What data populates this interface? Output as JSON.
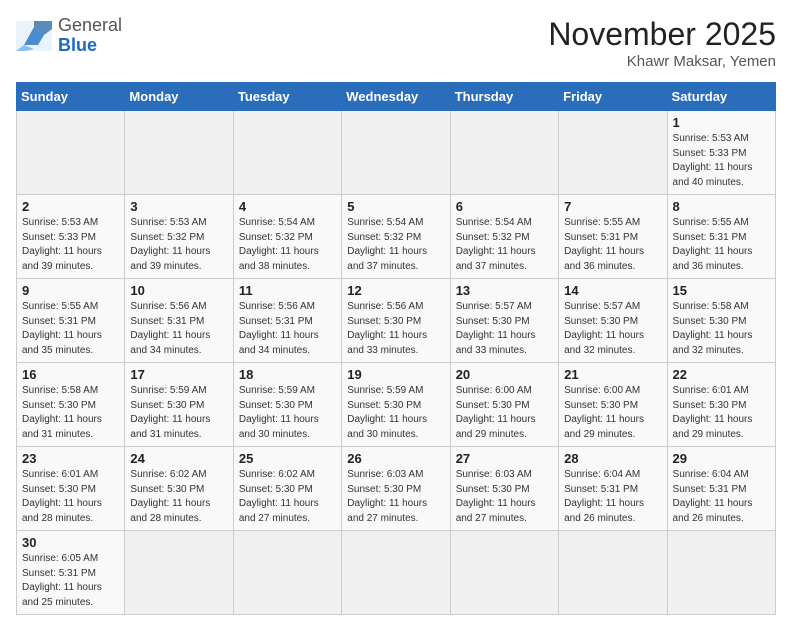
{
  "header": {
    "logo_general": "General",
    "logo_blue": "Blue",
    "month_year": "November 2025",
    "location": "Khawr Maksar, Yemen"
  },
  "weekdays": [
    "Sunday",
    "Monday",
    "Tuesday",
    "Wednesday",
    "Thursday",
    "Friday",
    "Saturday"
  ],
  "weeks": [
    [
      {
        "day": "",
        "info": ""
      },
      {
        "day": "",
        "info": ""
      },
      {
        "day": "",
        "info": ""
      },
      {
        "day": "",
        "info": ""
      },
      {
        "day": "",
        "info": ""
      },
      {
        "day": "",
        "info": ""
      },
      {
        "day": "1",
        "info": "Sunrise: 5:53 AM\nSunset: 5:33 PM\nDaylight: 11 hours\nand 40 minutes."
      }
    ],
    [
      {
        "day": "2",
        "info": "Sunrise: 5:53 AM\nSunset: 5:33 PM\nDaylight: 11 hours\nand 39 minutes."
      },
      {
        "day": "3",
        "info": "Sunrise: 5:53 AM\nSunset: 5:32 PM\nDaylight: 11 hours\nand 39 minutes."
      },
      {
        "day": "4",
        "info": "Sunrise: 5:54 AM\nSunset: 5:32 PM\nDaylight: 11 hours\nand 38 minutes."
      },
      {
        "day": "5",
        "info": "Sunrise: 5:54 AM\nSunset: 5:32 PM\nDaylight: 11 hours\nand 37 minutes."
      },
      {
        "day": "6",
        "info": "Sunrise: 5:54 AM\nSunset: 5:32 PM\nDaylight: 11 hours\nand 37 minutes."
      },
      {
        "day": "7",
        "info": "Sunrise: 5:55 AM\nSunset: 5:31 PM\nDaylight: 11 hours\nand 36 minutes."
      },
      {
        "day": "8",
        "info": "Sunrise: 5:55 AM\nSunset: 5:31 PM\nDaylight: 11 hours\nand 36 minutes."
      }
    ],
    [
      {
        "day": "9",
        "info": "Sunrise: 5:55 AM\nSunset: 5:31 PM\nDaylight: 11 hours\nand 35 minutes."
      },
      {
        "day": "10",
        "info": "Sunrise: 5:56 AM\nSunset: 5:31 PM\nDaylight: 11 hours\nand 34 minutes."
      },
      {
        "day": "11",
        "info": "Sunrise: 5:56 AM\nSunset: 5:31 PM\nDaylight: 11 hours\nand 34 minutes."
      },
      {
        "day": "12",
        "info": "Sunrise: 5:56 AM\nSunset: 5:30 PM\nDaylight: 11 hours\nand 33 minutes."
      },
      {
        "day": "13",
        "info": "Sunrise: 5:57 AM\nSunset: 5:30 PM\nDaylight: 11 hours\nand 33 minutes."
      },
      {
        "day": "14",
        "info": "Sunrise: 5:57 AM\nSunset: 5:30 PM\nDaylight: 11 hours\nand 32 minutes."
      },
      {
        "day": "15",
        "info": "Sunrise: 5:58 AM\nSunset: 5:30 PM\nDaylight: 11 hours\nand 32 minutes."
      }
    ],
    [
      {
        "day": "16",
        "info": "Sunrise: 5:58 AM\nSunset: 5:30 PM\nDaylight: 11 hours\nand 31 minutes."
      },
      {
        "day": "17",
        "info": "Sunrise: 5:59 AM\nSunset: 5:30 PM\nDaylight: 11 hours\nand 31 minutes."
      },
      {
        "day": "18",
        "info": "Sunrise: 5:59 AM\nSunset: 5:30 PM\nDaylight: 11 hours\nand 30 minutes."
      },
      {
        "day": "19",
        "info": "Sunrise: 5:59 AM\nSunset: 5:30 PM\nDaylight: 11 hours\nand 30 minutes."
      },
      {
        "day": "20",
        "info": "Sunrise: 6:00 AM\nSunset: 5:30 PM\nDaylight: 11 hours\nand 29 minutes."
      },
      {
        "day": "21",
        "info": "Sunrise: 6:00 AM\nSunset: 5:30 PM\nDaylight: 11 hours\nand 29 minutes."
      },
      {
        "day": "22",
        "info": "Sunrise: 6:01 AM\nSunset: 5:30 PM\nDaylight: 11 hours\nand 29 minutes."
      }
    ],
    [
      {
        "day": "23",
        "info": "Sunrise: 6:01 AM\nSunset: 5:30 PM\nDaylight: 11 hours\nand 28 minutes."
      },
      {
        "day": "24",
        "info": "Sunrise: 6:02 AM\nSunset: 5:30 PM\nDaylight: 11 hours\nand 28 minutes."
      },
      {
        "day": "25",
        "info": "Sunrise: 6:02 AM\nSunset: 5:30 PM\nDaylight: 11 hours\nand 27 minutes."
      },
      {
        "day": "26",
        "info": "Sunrise: 6:03 AM\nSunset: 5:30 PM\nDaylight: 11 hours\nand 27 minutes."
      },
      {
        "day": "27",
        "info": "Sunrise: 6:03 AM\nSunset: 5:30 PM\nDaylight: 11 hours\nand 27 minutes."
      },
      {
        "day": "28",
        "info": "Sunrise: 6:04 AM\nSunset: 5:31 PM\nDaylight: 11 hours\nand 26 minutes."
      },
      {
        "day": "29",
        "info": "Sunrise: 6:04 AM\nSunset: 5:31 PM\nDaylight: 11 hours\nand 26 minutes."
      }
    ],
    [
      {
        "day": "30",
        "info": "Sunrise: 6:05 AM\nSunset: 5:31 PM\nDaylight: 11 hours\nand 25 minutes."
      },
      {
        "day": "",
        "info": ""
      },
      {
        "day": "",
        "info": ""
      },
      {
        "day": "",
        "info": ""
      },
      {
        "day": "",
        "info": ""
      },
      {
        "day": "",
        "info": ""
      },
      {
        "day": "",
        "info": ""
      }
    ]
  ]
}
